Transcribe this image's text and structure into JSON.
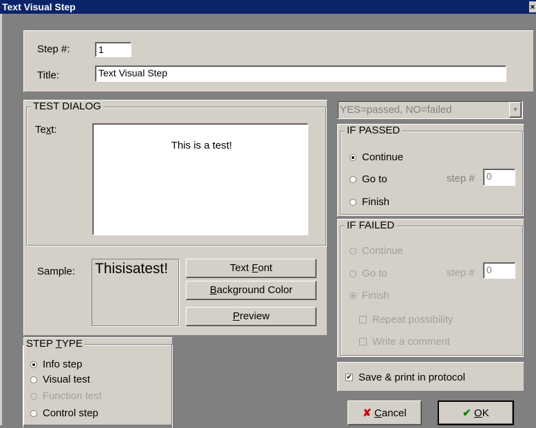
{
  "window": {
    "title": "Text Visual Step",
    "close_glyph": "×"
  },
  "header": {
    "step_label": "Step #:",
    "step_value": "1",
    "title_label": "Title:",
    "title_value": "Text Visual Step"
  },
  "test_dialog": {
    "legend": "TEST DIALOG",
    "text_label_pre": "Te",
    "text_label_mn": "x",
    "text_label_post": "t:",
    "text_value": "This is a test!",
    "sample_label": "Sample:",
    "sample_text": "Thisisatest!",
    "font_button_pre": "Text ",
    "font_button_mn": "F",
    "font_button_post": "ont",
    "bg_button_mn": "B",
    "bg_button_post": "ackground Color",
    "preview_button_mn": "P",
    "preview_button_post": "review"
  },
  "step_type": {
    "legend_pre": "STEP ",
    "legend_mn": "T",
    "legend_post": "YPE",
    "options": [
      "Info step",
      "Visual test",
      "Function test",
      "Control step"
    ]
  },
  "result_select": {
    "value": "YES=passed, NO=failed",
    "arrow": "▼"
  },
  "if_passed": {
    "legend": "IF PASSED",
    "continue": "Continue",
    "goto": "Go to",
    "finish": "Finish",
    "step_label": "step #",
    "step_value": "0"
  },
  "if_failed": {
    "legend": "IF FAILED",
    "continue": "Continue",
    "goto": "Go to",
    "finish": "Finish",
    "step_label": "step #",
    "step_value": "0",
    "repeat": "Repeat possibility",
    "comment": "Write a comment"
  },
  "save_print": {
    "label": "Save & print in protocol",
    "check_mark": "✔"
  },
  "buttons": {
    "cancel_icon": "✘",
    "cancel_mn": "C",
    "cancel_post": "ancel",
    "ok_icon": "✔",
    "ok_mn": "O",
    "ok_post": "K"
  },
  "colors": {
    "title_bg": "#0a246a",
    "face": "#d4d0c8",
    "backdrop": "#808080",
    "cancel_red": "#cc0000",
    "ok_green": "#008000"
  }
}
